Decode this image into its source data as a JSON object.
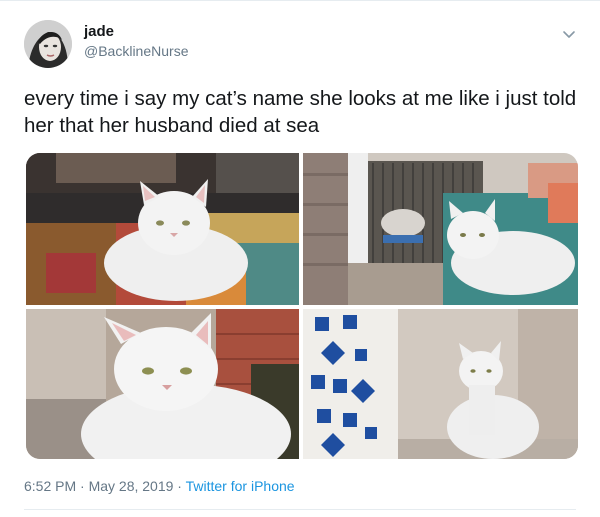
{
  "tweet": {
    "author": {
      "display_name": "jade",
      "handle": "@BacklineNurse",
      "avatar_icon": "user-avatar"
    },
    "text": "every time i say my cat’s name she looks at me like i just told her that her husband died at sea",
    "media": {
      "photo_count": 4
    },
    "timestamp": "6:52 PM · May 28, 2019 · ",
    "source": "Twitter for iPhone",
    "colors": {
      "text": "#14171a",
      "secondary": "#657786",
      "link": "#1b95e0"
    }
  }
}
